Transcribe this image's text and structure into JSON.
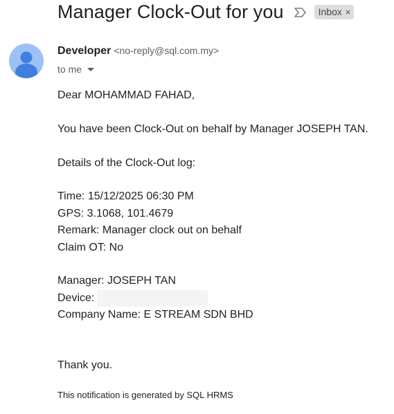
{
  "email": {
    "subject": "Manager Clock-Out for you",
    "label": "Inbox",
    "label_remove": "×",
    "sender_name": "Developer",
    "sender_email": "<no-reply@sql.com.my>",
    "recipient_summary": "to me",
    "body": {
      "greeting": "Dear MOHAMMAD FAHAD,",
      "intro": "You have been Clock-Out on behalf by Manager JOSEPH TAN.",
      "details_heading": "Details of the Clock-Out log:",
      "time": "Time: 15/12/2025 06:30 PM",
      "gps": "GPS: 3.1068, 101.4679",
      "remark": "Remark: Manager clock out on behalf",
      "claim_ot": "Claim OT: No",
      "manager": "Manager: JOSEPH TAN",
      "device_label": "Device:",
      "company": "Company Name: E STREAM SDN BHD",
      "thanks": "Thank you."
    },
    "footer": "This notification is generated by SQL HRMS"
  },
  "icons": {
    "importance": "importance-marker-icon",
    "avatar": "default-avatar-icon",
    "caret": "caret-down-icon"
  },
  "colors": {
    "avatar_bg": "#9fc0f5",
    "avatar_figure": "#3f7fe0",
    "label_chip": "#dddddd"
  }
}
